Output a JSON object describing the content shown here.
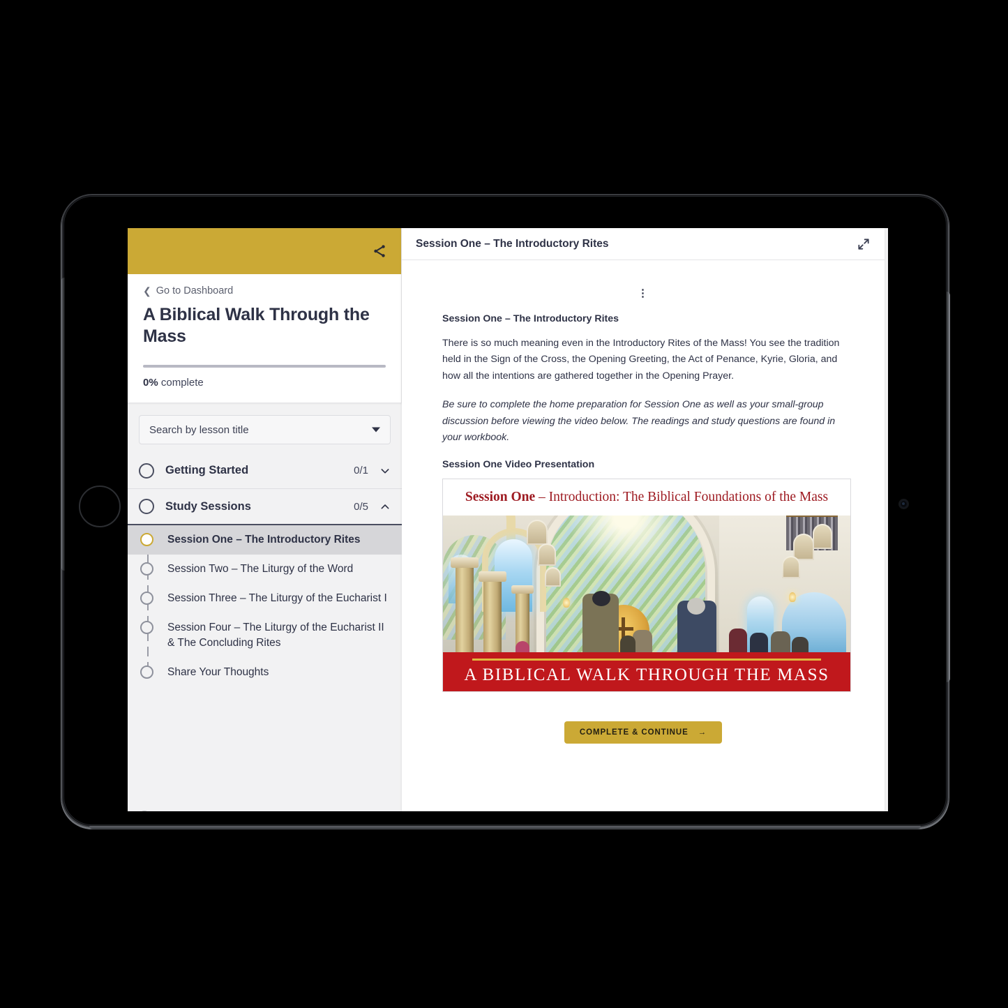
{
  "sidebar": {
    "share_icon": "share-icon",
    "back_link": "Go to Dashboard",
    "course_title": "A Biblical Walk Through the Mass",
    "progress_percent": "0%",
    "progress_suffix": " complete",
    "progress_value": 0,
    "search_placeholder": "Search by lesson title",
    "sections": [
      {
        "label": "Getting Started",
        "count": "0/1",
        "expanded": false,
        "chevron": "chevron-down-icon"
      },
      {
        "label": "Study Sessions",
        "count": "0/5",
        "expanded": true,
        "chevron": "chevron-up-icon"
      }
    ],
    "lessons": [
      {
        "label": "Session One – The Introductory Rites",
        "active": true
      },
      {
        "label": "Session Two – The Liturgy of the Word",
        "active": false
      },
      {
        "label": "Session Three – The Liturgy of the Eucharist I",
        "active": false
      },
      {
        "label": "Session Four – The Liturgy of the Eucharist II & The Concluding Rites",
        "active": false
      },
      {
        "label": "Share Your Thoughts",
        "active": false
      }
    ]
  },
  "content": {
    "header_title": "Session One – The Introductory Rites",
    "expand_icon": "expand-icon",
    "dots_marker": "⋮",
    "body_heading": "Session One – The Introductory Rites",
    "paragraph_1": "There is so much meaning even in the Introductory Rites of the Mass! You see the tradition held in the Sign of the Cross, the Opening Greeting, the Act of Penance, Kyrie, Gloria, and how all the intentions are gathered together in the Opening Prayer.",
    "paragraph_2": "Be sure to complete the home preparation for Session One as well as your small-group discussion before viewing the video below. The readings and study questions are found in your workbook.",
    "video_heading": "Session One Video Presentation",
    "video_thumbnail": {
      "title_bold": "Session One",
      "title_rest": " – Introduction: The Biblical Foundations of the Mass",
      "banner_text": "A BIBLICAL WALK THROUGH THE MASS",
      "alt": "Church interior with congregation facing a painted apse"
    },
    "cta_label": "COMPLETE & CONTINUE",
    "cta_arrow": "arrow-right-icon"
  },
  "device": {
    "home_button": "home-button",
    "camera": "front-camera-icon"
  },
  "colors": {
    "gold": "#cba935",
    "dark_text": "#2e3246",
    "red_banner": "#c0181c",
    "thumb_title_red": "#9e1b22",
    "active_row": "#d6d6d9"
  }
}
